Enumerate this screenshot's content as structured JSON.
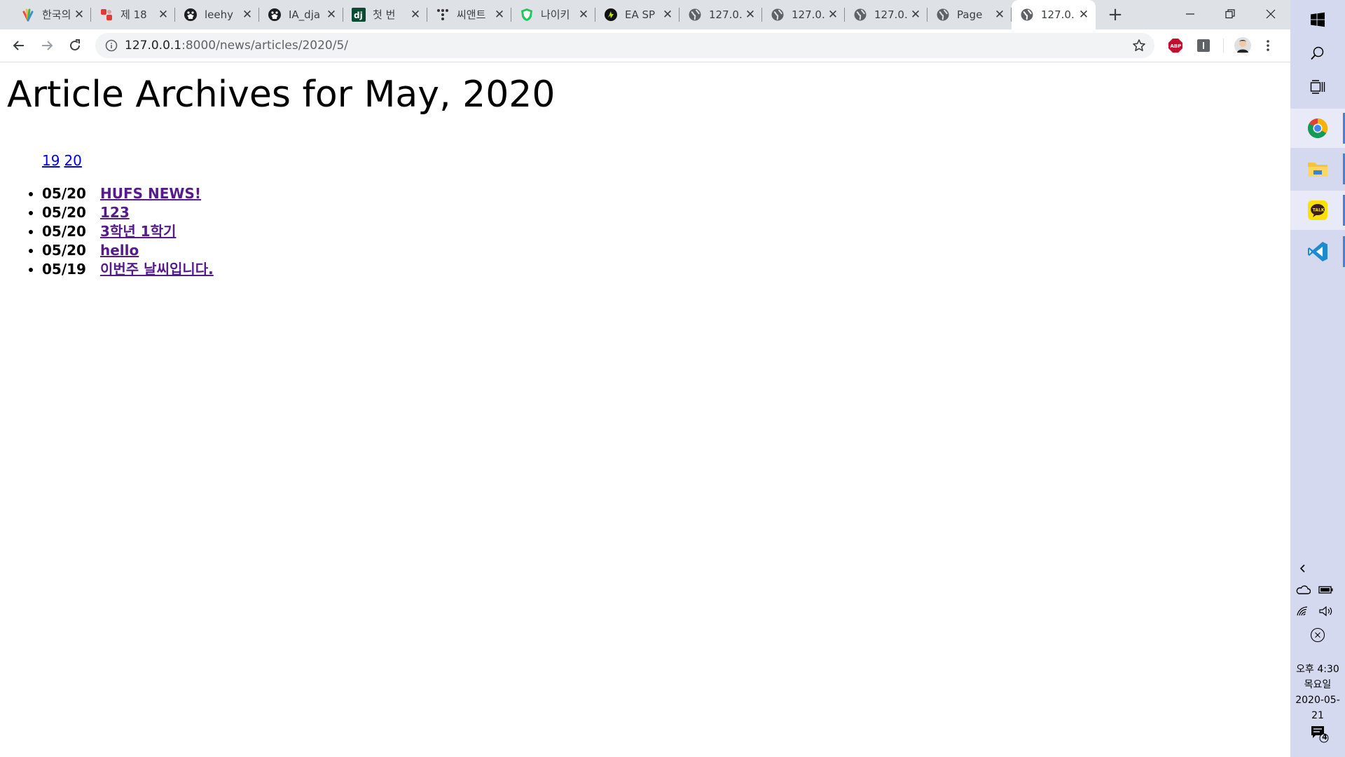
{
  "browser": {
    "tabs": [
      {
        "title": "한국의",
        "icon": "colorful-hand-icon"
      },
      {
        "title": "제 18",
        "icon": "red-puzzle-icon"
      },
      {
        "title": "leehy",
        "icon": "github-icon"
      },
      {
        "title": "IA_dja",
        "icon": "github-icon"
      },
      {
        "title": "첫 번",
        "icon": "django-icon"
      },
      {
        "title": "씨앤트",
        "icon": "dots-icon"
      },
      {
        "title": "나이키",
        "icon": "green-shield-icon"
      },
      {
        "title": "EA SP",
        "icon": "ea-icon"
      },
      {
        "title": "127.0.",
        "icon": "globe-icon"
      },
      {
        "title": "127.0.",
        "icon": "globe-icon"
      },
      {
        "title": "127.0.",
        "icon": "globe-icon"
      },
      {
        "title": "Page",
        "icon": "globe-icon"
      },
      {
        "title": "127.0.",
        "icon": "globe-icon",
        "active": true
      }
    ],
    "url_host": "127.0.0.1",
    "url_path": ":8000/news/articles/2020/5/",
    "colors": {
      "tabstrip": "#dee1e6",
      "omnibox": "#f1f3f4",
      "abp": "#c70d2c"
    }
  },
  "page": {
    "title": "Article Archives for May, 2020",
    "day_links": [
      "19",
      "20"
    ],
    "articles": [
      {
        "date": "05/20",
        "title": "HUFS NEWS!"
      },
      {
        "date": "05/20",
        "title": "123"
      },
      {
        "date": "05/20",
        "title": "3학년 1학기"
      },
      {
        "date": "05/20",
        "title": "hello"
      },
      {
        "date": "05/19",
        "title": "이번주 날씨입니다."
      }
    ],
    "colors": {
      "link": "#0000ee",
      "visited": "#551a8b"
    }
  },
  "taskbar": {
    "clock_ampm_time": "오후 4:30",
    "clock_weekday": "목요일",
    "clock_date": "2020-05-21",
    "notification_count": "4",
    "kakao_label": "TALK"
  }
}
